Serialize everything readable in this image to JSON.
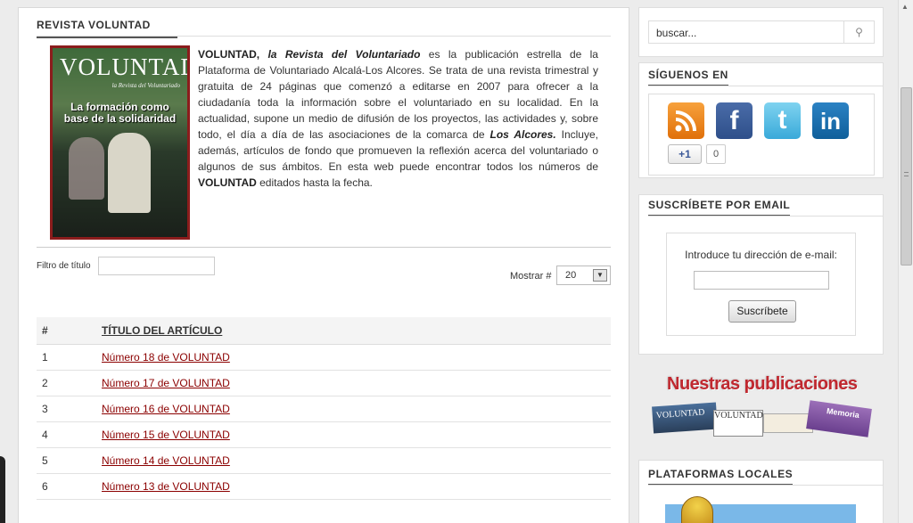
{
  "main": {
    "section_title": "REVISTA VOLUNTAD",
    "cover": {
      "magazine_name": "VOLUNTAD",
      "subtitle": "la Revista del Voluntariado",
      "headline": "La formación como base de la solidaridad"
    },
    "intro": {
      "brand": "VOLUNTAD,",
      "brand_sub": "la Revista del Voluntariado",
      "part1": " es la publicación estrella de la Plataforma de Voluntariado Alcalá-Los Alcores. Se trata de una revista trimestral y gratuita de 24 páginas que comenzó a editarse en 2007 para ofrecer a la ciudadanía toda la información sobre el voluntariado en su localidad. En la actualidad, supone un medio de difusión  de los proyectos, las actividades y, sobre todo, el día a día de las asociaciones de la comarca de ",
      "los_alcores": "Los Alcores.",
      "part2": " Incluye, además, artículos de fondo que promueven la reflexión acerca del voluntariado o algunos de sus ámbitos. En esta web puede encontrar todos los números de ",
      "brand2": "VOLUNTAD",
      "part3": " editados hasta la fecha."
    },
    "filter_label": "Filtro de título",
    "filter_value": "",
    "show_label": "Mostrar #",
    "show_value": "20",
    "table": {
      "col_num": "#",
      "col_title": "TÍTULO DEL ARTÍCULO",
      "rows": [
        {
          "num": "1",
          "title": "Número 18 de VOLUNTAD"
        },
        {
          "num": "2",
          "title": "Número 17 de VOLUNTAD"
        },
        {
          "num": "3",
          "title": "Número 16 de VOLUNTAD"
        },
        {
          "num": "4",
          "title": "Número 15 de VOLUNTAD"
        },
        {
          "num": "5",
          "title": "Número 14 de VOLUNTAD"
        },
        {
          "num": "6",
          "title": "Número 13 de VOLUNTAD"
        }
      ]
    }
  },
  "sidebar": {
    "search_placeholder": "buscar...",
    "search_icon": "search-icon",
    "follow_title": "SÍGUENOS EN",
    "social": {
      "plus_label": "+1",
      "plus_count": "0"
    },
    "subscribe_title": "SUSCRÍBETE POR EMAIL",
    "subscribe_label": "Introduce tu dirección de e-mail:",
    "subscribe_button": "Suscríbete",
    "pubs_title": "Nuestras publicaciones",
    "pubs": {
      "pub1": "VOLUNTAD",
      "pub2": "VOLUNTAD",
      "pub4": "Memoria"
    },
    "local_title": "PLATAFORMAS LOCALES"
  }
}
